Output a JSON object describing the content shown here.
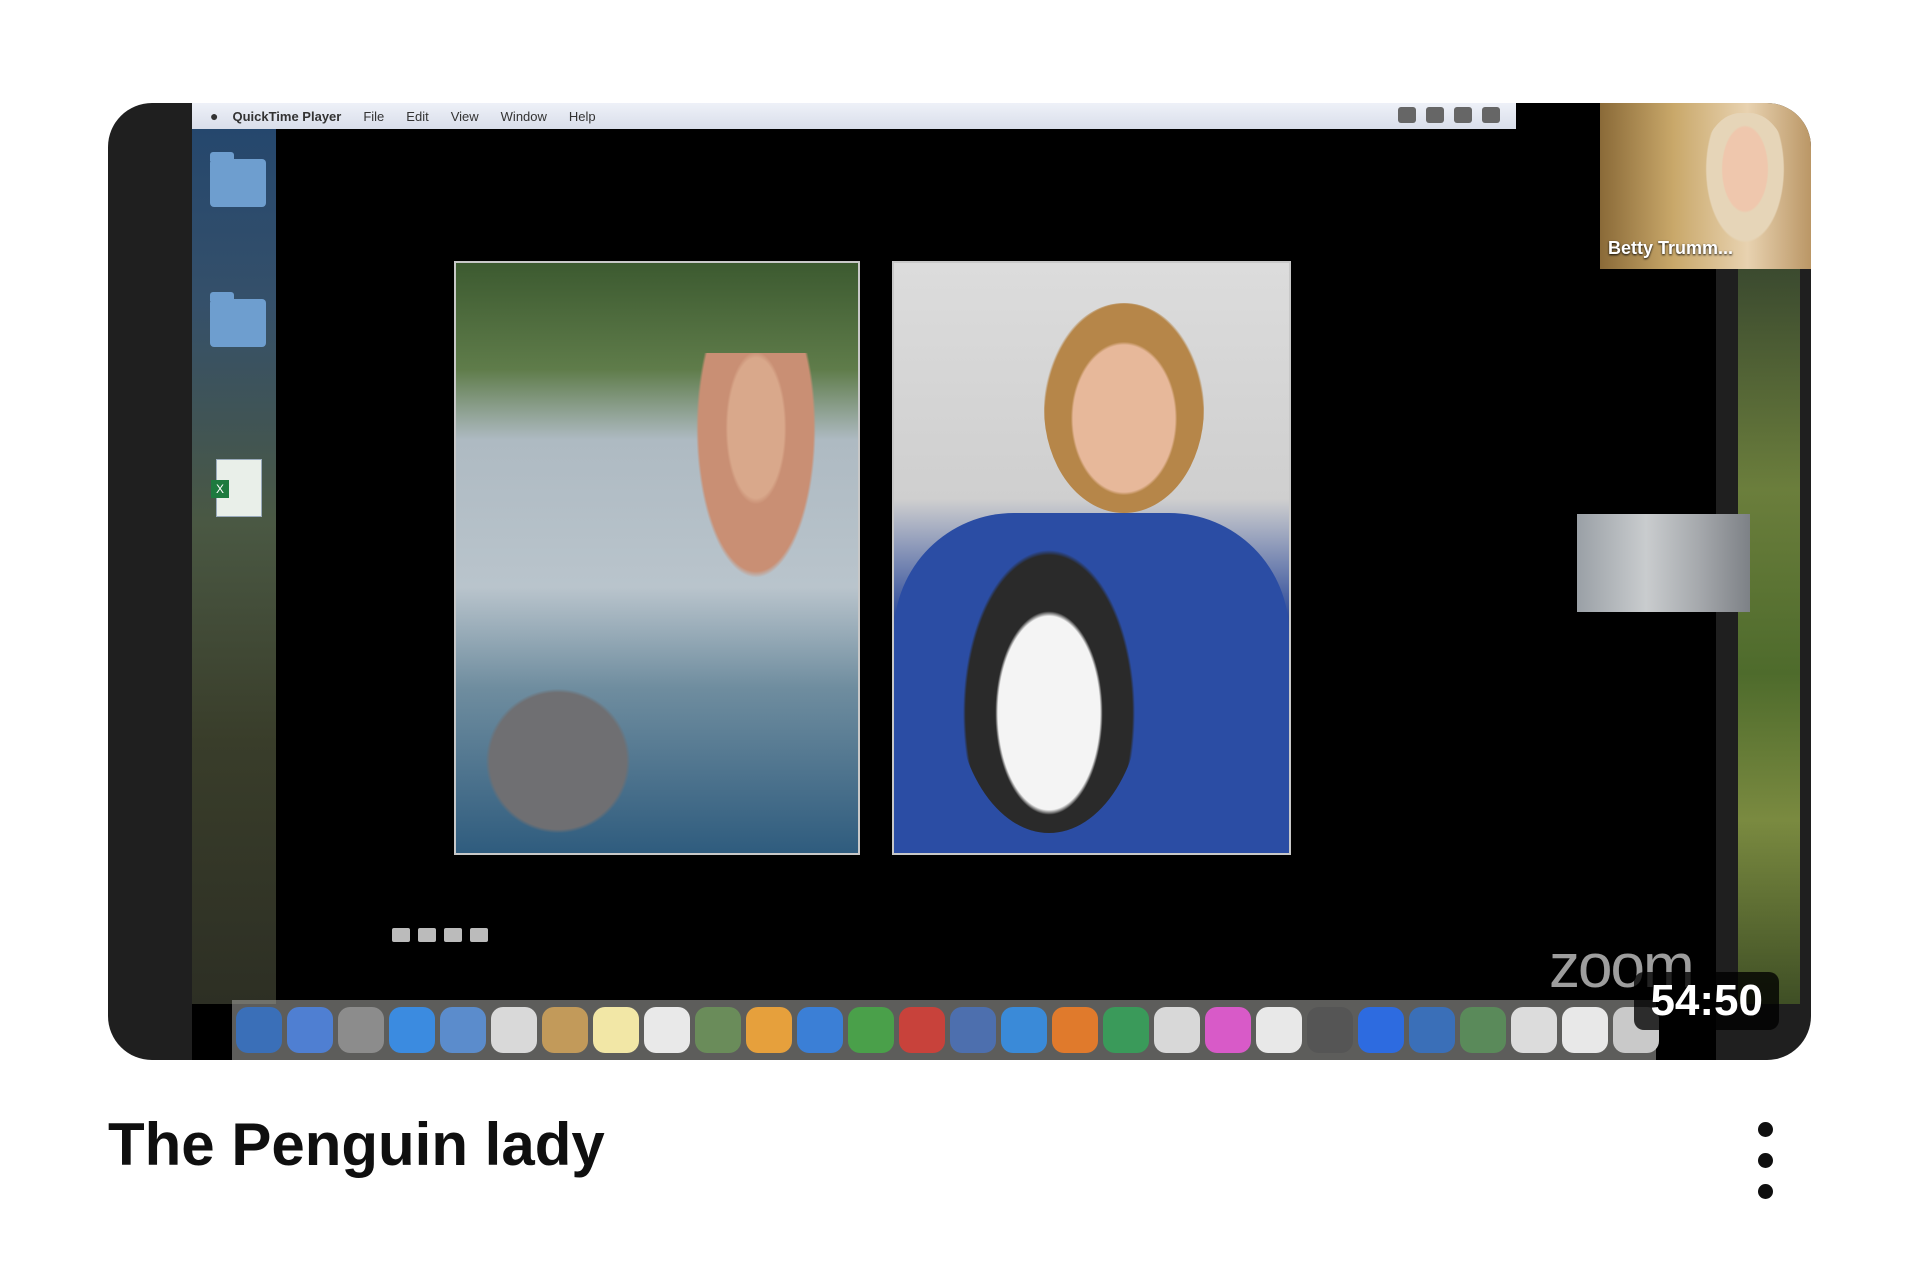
{
  "video": {
    "title": "The Penguin lady",
    "duration": "54:50"
  },
  "screen_share": {
    "menubar": {
      "app_name": "QuickTime Player",
      "menus": [
        "File",
        "Edit",
        "View",
        "Window",
        "Help"
      ]
    },
    "participants": {
      "main_name": "Betty Trumm..."
    },
    "watermark": "zoom"
  },
  "dock_colors": [
    "#3a6fb8",
    "#4f7fd2",
    "#8c8c8c",
    "#3b8be0",
    "#5b8ccc",
    "#d9d9d9",
    "#c29a5a",
    "#f2e7a6",
    "#e9e9e9",
    "#6a8c5a",
    "#e6a03c",
    "#3b7fd6",
    "#4aa04a",
    "#c8423b",
    "#4d6fae",
    "#3a8ad8",
    "#e07a2c",
    "#3a9a5a",
    "#d8d8d8",
    "#d85ac8",
    "#e8e8e8",
    "#555555",
    "#2d6be0",
    "#3a6fb8",
    "#5a8a5a",
    "#dcdcdc",
    "#e8e8e8",
    "#c9c9c9"
  ]
}
